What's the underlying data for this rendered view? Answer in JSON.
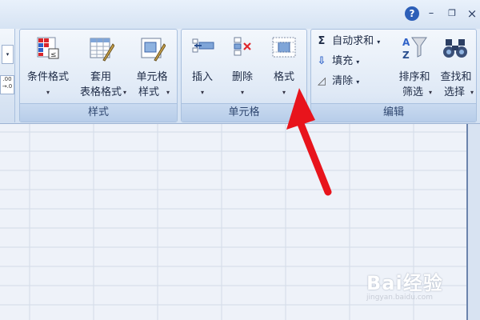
{
  "window": {
    "help_label": "?",
    "minimize_label": "–",
    "restore_label": "❐",
    "close_label": "×"
  },
  "styles_group": {
    "caption": "样式",
    "conditional_format": "条件格式",
    "table_format_l1": "套用",
    "table_format_l2": "表格格式",
    "cell_style_l1": "单元格",
    "cell_style_l2": "样式"
  },
  "cells_group": {
    "caption": "单元格",
    "insert": "插入",
    "delete": "删除",
    "format": "格式"
  },
  "edit_group": {
    "caption": "编辑",
    "autosum": "自动求和",
    "fill": "填充",
    "clear": "清除",
    "sort_l1": "排序和",
    "sort_l2": "筛选",
    "find_l1": "查找和",
    "find_l2": "选择"
  },
  "watermark": {
    "brand": "Bai经验",
    "url": "jingyan.baidu.com"
  },
  "colors": {
    "accent": "#2d5fb8",
    "arrow": "#e8141c"
  }
}
